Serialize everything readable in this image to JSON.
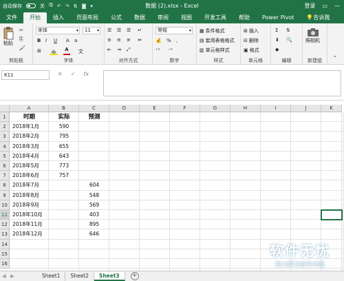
{
  "titlebar": {
    "autosave_label": "自动保存",
    "autosave_state": "关",
    "title": "数据 (2).xlsx  -  Excel",
    "login": "登录"
  },
  "tabs": [
    "文件",
    "开始",
    "插入",
    "页面布局",
    "公式",
    "数据",
    "审阅",
    "视图",
    "开发工具",
    "帮助",
    "Power Pivot",
    "告诉我"
  ],
  "active_tab": "开始",
  "ribbon": {
    "clipboard": {
      "paste": "粘贴",
      "label": "剪贴板"
    },
    "font": {
      "name": "宋体",
      "size": "11",
      "label": "字体",
      "font_color": "#d60000",
      "fill_color": "#ffd800"
    },
    "alignment": {
      "label": "对齐方式"
    },
    "number": {
      "format": "常规",
      "label": "数字"
    },
    "styles": {
      "conditional": "条件格式",
      "table": "套用表格格式",
      "cell": "单元格样式",
      "label": "样式"
    },
    "cells": {
      "insert": "插入",
      "delete": "删除",
      "format": "格式",
      "label": "单元格"
    },
    "editing": {
      "label": "编辑"
    },
    "camera": {
      "btn": "照相机",
      "label": "新建组"
    }
  },
  "formula_bar": {
    "namebox": "K11",
    "fx": "fx",
    "formula": ""
  },
  "columns": [
    "A",
    "B",
    "C",
    "D",
    "E",
    "F",
    "G",
    "H",
    "I",
    "J",
    "K"
  ],
  "rows": [
    "1",
    "2",
    "3",
    "4",
    "5",
    "6",
    "7",
    "8",
    "9",
    "10",
    "11",
    "12",
    "13",
    "14",
    "15",
    "16"
  ],
  "selected_row": "11",
  "selected_cell": "K11",
  "table": {
    "headers": [
      "时期",
      "实际",
      "预测"
    ],
    "data": [
      [
        "2018年1月",
        "590",
        ""
      ],
      [
        "2018年2月",
        "795",
        ""
      ],
      [
        "2018年3月",
        "655",
        ""
      ],
      [
        "2018年4月",
        "643",
        ""
      ],
      [
        "2018年5月",
        "773",
        ""
      ],
      [
        "2018年6月",
        "757",
        ""
      ],
      [
        "2018年7月",
        "",
        "604"
      ],
      [
        "2018年8月",
        "",
        "548"
      ],
      [
        "2018年9月",
        "",
        "569"
      ],
      [
        "2018年10月",
        "",
        "403"
      ],
      [
        "2018年11月",
        "",
        "895"
      ],
      [
        "2018年12月",
        "",
        "646"
      ]
    ]
  },
  "sheets": [
    "Sheet1",
    "Sheet2",
    "Sheet3"
  ],
  "active_sheet": "Sheet3",
  "watermark": {
    "title": "软件无忧",
    "sub": "努力解决软件问题"
  },
  "accent": "#217346"
}
